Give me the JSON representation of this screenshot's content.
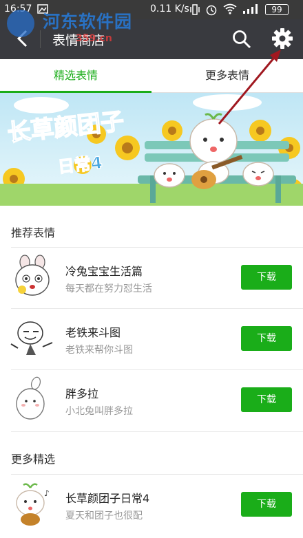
{
  "status_bar": {
    "time": "16:57",
    "net_speed": "0.11 K/s",
    "battery": "99"
  },
  "app_bar": {
    "title": "表情商店"
  },
  "watermark": {
    "text": "河东软件园",
    "url": "359.cn"
  },
  "tabs": [
    {
      "label": "精选表情",
      "active": true
    },
    {
      "label": "更多表情",
      "active": false
    }
  ],
  "banner": {
    "title": "长草颜团子",
    "subtitle": "日常4"
  },
  "sections": {
    "recommended": "推荐表情",
    "more": "更多精选"
  },
  "recommended_items": [
    {
      "name": "冷兔宝宝生活篇",
      "desc": "每天都在努力怼生活",
      "button": "下载"
    },
    {
      "name": "老铁来斗图",
      "desc": "老铁来帮你斗图",
      "button": "下载"
    },
    {
      "name": "胖多拉",
      "desc": "小北兔叫胖多拉",
      "button": "下载"
    }
  ],
  "more_items": [
    {
      "name": "长草颜团子日常4",
      "desc": "夏天和团子也很配",
      "button": "下载"
    }
  ],
  "colors": {
    "accent": "#1aad19",
    "appbar": "#393a3f",
    "arrow": "#a01820"
  }
}
